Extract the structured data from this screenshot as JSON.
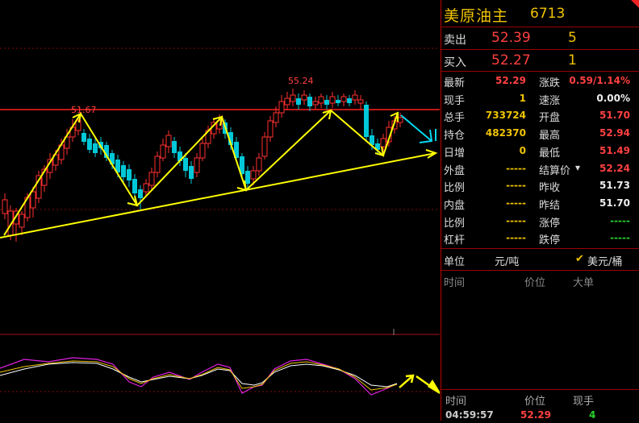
{
  "header": {
    "title": "美原油主",
    "code": "6713"
  },
  "bid_ask": {
    "sell_label": "卖出",
    "sell_price": "52.39",
    "sell_volume": "5",
    "buy_label": "买入",
    "buy_price": "52.27",
    "buy_volume": "1"
  },
  "quote": {
    "left": [
      {
        "label": "最新",
        "value": "52.29",
        "color": "red"
      },
      {
        "label": "现手",
        "value": "1",
        "color": "yel"
      },
      {
        "label": "总手",
        "value": "733724",
        "color": "yel"
      },
      {
        "label": "持仓",
        "value": "482370",
        "color": "yel"
      },
      {
        "label": "日增",
        "value": "0",
        "color": "yel"
      },
      {
        "label": "外盘",
        "value": "-----",
        "color": "yel"
      },
      {
        "label": "比例",
        "value": "-----",
        "color": "yel"
      },
      {
        "label": "内盘",
        "value": "-----",
        "color": "yel"
      },
      {
        "label": "比例",
        "value": "-----",
        "color": "yel"
      },
      {
        "label": "杠杆",
        "value": "-----",
        "color": "yel"
      }
    ],
    "right": [
      {
        "label": "涨跌",
        "value": "0.59/1.14%",
        "color": "red"
      },
      {
        "label": "速涨",
        "value": "0.00%",
        "color": "wht"
      },
      {
        "label": "开盘",
        "value": "51.70",
        "color": "red"
      },
      {
        "label": "最高",
        "value": "52.94",
        "color": "red"
      },
      {
        "label": "最低",
        "value": "51.49",
        "color": "red"
      },
      {
        "label": "结算价",
        "value": "52.24",
        "color": "red"
      },
      {
        "label": "昨收",
        "value": "51.73",
        "color": "wht"
      },
      {
        "label": "昨结",
        "value": "51.70",
        "color": "wht"
      },
      {
        "label": "涨停",
        "value": "-----",
        "color": "grn"
      },
      {
        "label": "跌停",
        "value": "-----",
        "color": "grn"
      }
    ]
  },
  "unit": {
    "label": "单位",
    "option1": "元/吨",
    "option2": "美元/桶",
    "checked": "✔"
  },
  "big_order": {
    "col_time": "时间",
    "col_price": "价位",
    "col_big": "大单"
  },
  "ticks": {
    "col_time": "时间",
    "col_price": "价位",
    "col_volume": "现手",
    "rows": [
      {
        "time": "04:59:57",
        "price": "52.29",
        "volume": "4"
      }
    ]
  },
  "chart": {
    "high_label": "55.24",
    "level_label": "51.67"
  },
  "colors": {
    "up": "#ff3030",
    "down": "#00c8d8",
    "trend": "#ffff00",
    "accent": "#f0c400"
  }
}
